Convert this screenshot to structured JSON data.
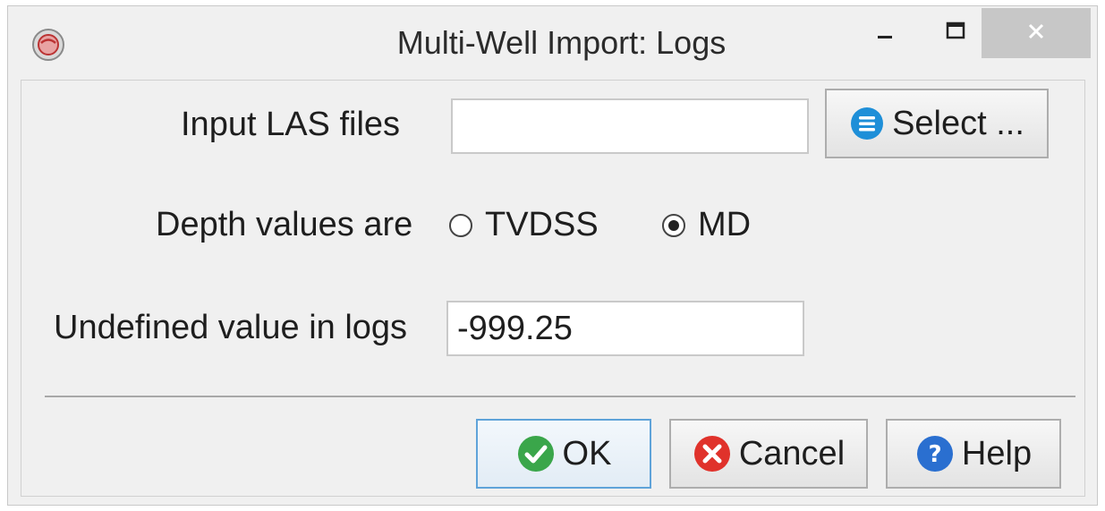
{
  "window": {
    "title": "Multi-Well Import: Logs",
    "controls": {
      "minimize": "minimize-icon",
      "maximize": "maximize-icon",
      "close": "close-icon"
    }
  },
  "form": {
    "las_files": {
      "label": "Input LAS files",
      "value": "",
      "select_button": "Select ..."
    },
    "depth": {
      "label": "Depth values are",
      "options": [
        "TVDSS",
        "MD"
      ],
      "selected": "MD"
    },
    "undefined_value": {
      "label": "Undefined value in logs",
      "value": "-999.25"
    }
  },
  "buttons": {
    "ok": "OK",
    "cancel": "Cancel",
    "help": "Help"
  },
  "colors": {
    "ok_icon": "#3aa64a",
    "cancel_icon": "#e0322b",
    "help_icon": "#2a6fd0",
    "select_icon": "#1e8fd8",
    "default_button_border": "#5fa3d9"
  }
}
